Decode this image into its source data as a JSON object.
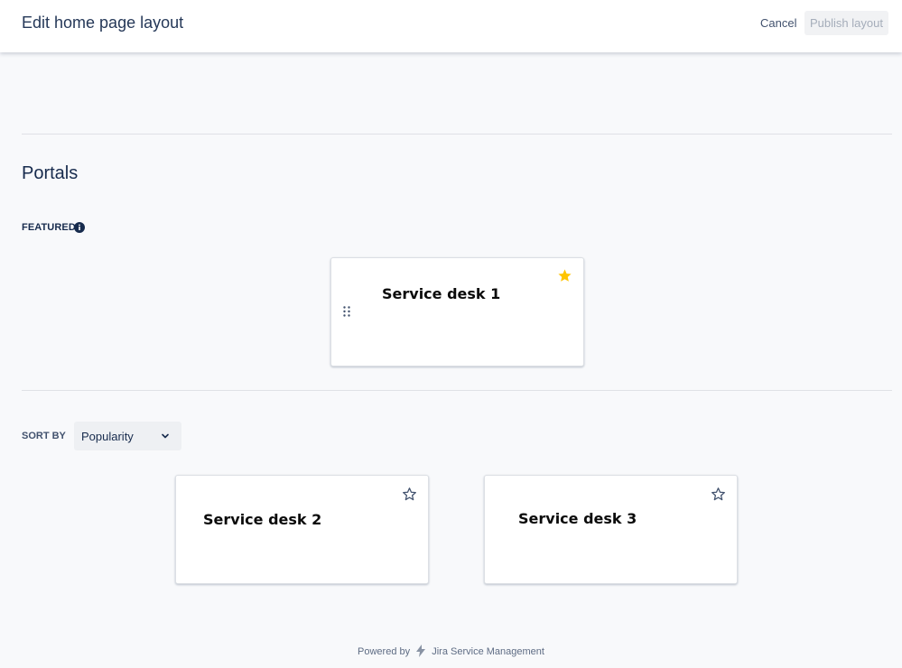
{
  "header": {
    "title": "Edit home page layout",
    "cancel_label": "Cancel",
    "publish_label": "Publish layout"
  },
  "portals": {
    "section_title": "Portals",
    "featured_label": "FEATURED",
    "featured": [
      {
        "name": "Service desk 1",
        "starred": true
      }
    ],
    "sort_by_label": "SORT BY",
    "sort_value": "Popularity",
    "items": [
      {
        "name": "Service desk 2",
        "starred": false
      },
      {
        "name": "Service desk 3",
        "starred": false
      }
    ]
  },
  "footer": {
    "powered_by": "Powered by",
    "product": "Jira Service Management"
  },
  "colors": {
    "star_filled": "#ffc400",
    "star_outline": "#42526e",
    "publish_disabled_text": "#a5adba"
  },
  "icons": [
    "info-icon",
    "star-filled-icon",
    "star-outline-icon",
    "drag-handle-icon",
    "chevron-down-icon",
    "jira-logo-icon"
  ]
}
